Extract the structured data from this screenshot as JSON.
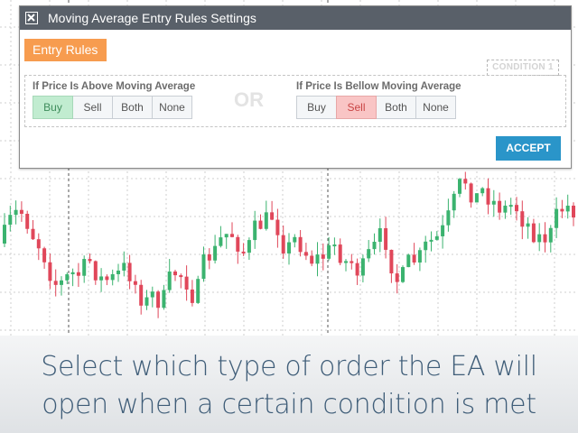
{
  "dialog": {
    "title": "Moving Average Entry Rules Settings",
    "close_icon": "close-icon",
    "tab_label": "Entry Rules",
    "condition_badge": "CONDITION 1",
    "or_label": "OR",
    "accept_label": "ACCEPT",
    "groups": [
      {
        "label": "If Price Is Above Moving Average",
        "options": [
          "Buy",
          "Sell",
          "Both",
          "None"
        ],
        "selected": "Buy"
      },
      {
        "label": "If Price Is Bellow Moving Average",
        "options": [
          "Buy",
          "Sell",
          "Both",
          "None"
        ],
        "selected": "Sell"
      }
    ]
  },
  "colors": {
    "titlebar": "#596069",
    "tab": "#f79c4f",
    "accept": "#2a95c9",
    "bull_candle": "#3bb36f",
    "bear_candle": "#e0475a",
    "buy_selected": "#c1ecd0",
    "sell_selected": "#f9c5c5",
    "caption_text": "#3f5d78"
  },
  "caption": {
    "line1": "Select which type of order the EA will",
    "line2": "open when a certain condition is met"
  }
}
